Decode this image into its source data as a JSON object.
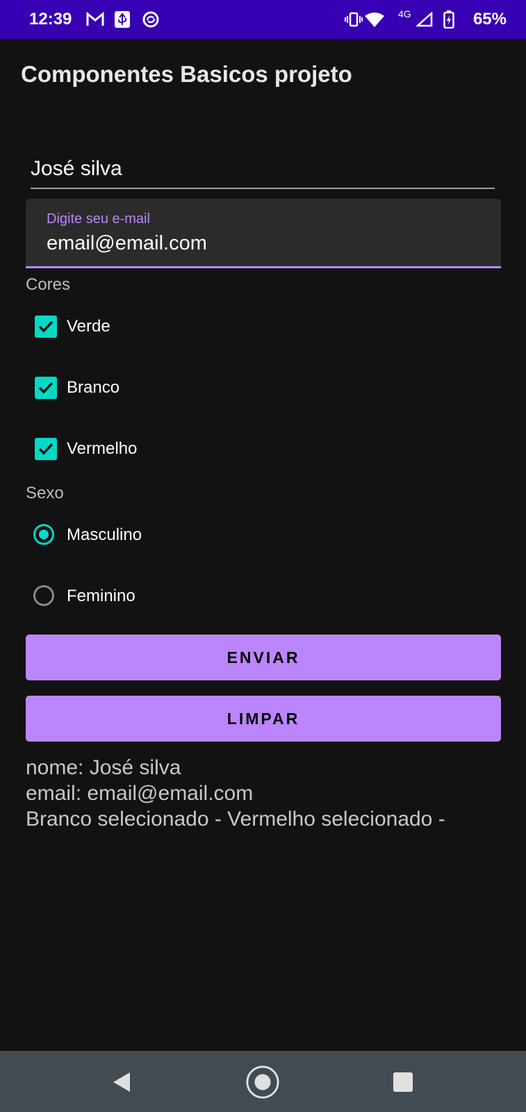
{
  "status_bar": {
    "time": "12:39",
    "network": "4G",
    "battery": "65%",
    "icons": [
      "gmail-icon",
      "usb-icon",
      "sync-icon",
      "vibrate-icon",
      "wifi-icon",
      "signal-icon",
      "battery-charging-icon"
    ]
  },
  "app": {
    "title": "Componentes Basicos projeto"
  },
  "form": {
    "name_value": "José silva",
    "email_label": "Digite seu e-mail",
    "email_value": "email@email.com",
    "colors_label": "Cores",
    "colors": [
      {
        "label": "Verde",
        "checked": true
      },
      {
        "label": "Branco",
        "checked": true
      },
      {
        "label": "Vermelho",
        "checked": true
      }
    ],
    "sex_label": "Sexo",
    "sex_options": [
      {
        "label": "Masculino",
        "selected": true
      },
      {
        "label": "Feminino",
        "selected": false
      }
    ],
    "submit_label": "ENVIAR",
    "clear_label": "LIMPAR"
  },
  "result": {
    "line1": "nome: José silva",
    "line2": "email: email@email.com",
    "line3": "Branco selecionado - Vermelho selecionado -"
  },
  "nav_bar": {
    "icons": [
      "back-icon",
      "home-icon",
      "recents-icon"
    ]
  },
  "colors": {
    "status_bar": "#3700b3",
    "accent": "#bb86fc",
    "secondary": "#03dac6",
    "background": "#121212"
  }
}
